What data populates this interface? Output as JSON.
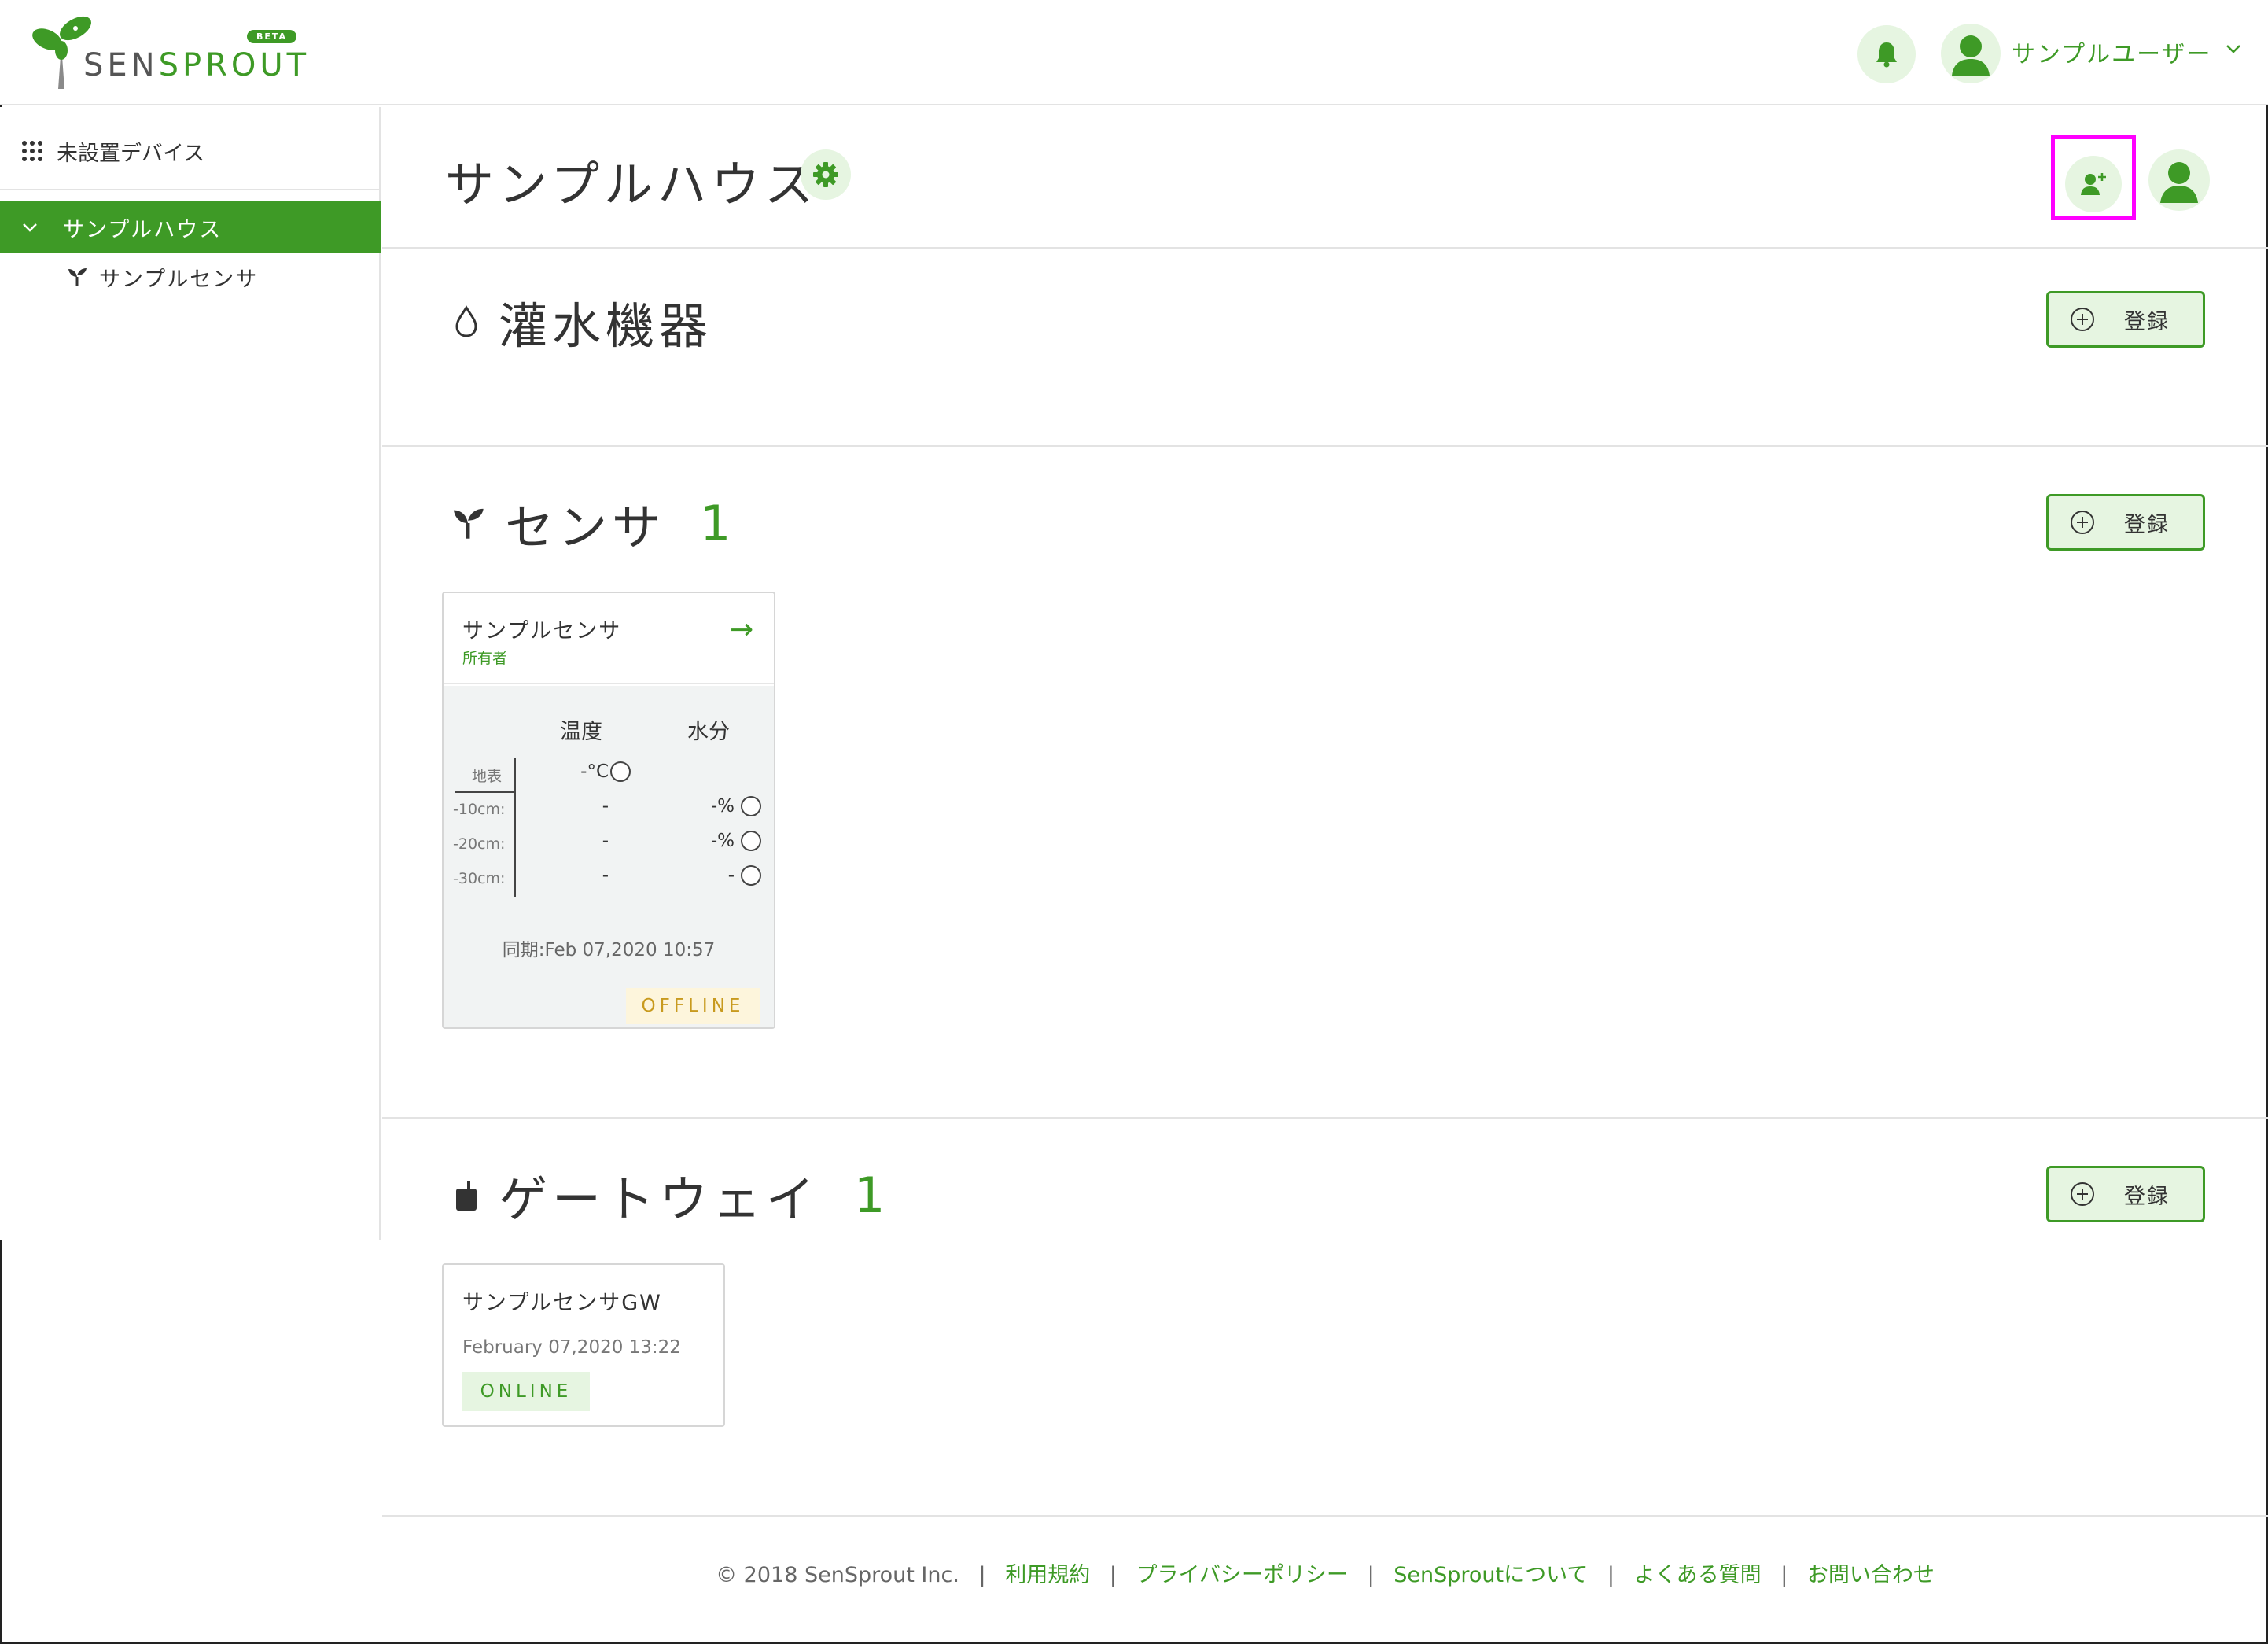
{
  "header": {
    "logo_text_a": "SEN",
    "logo_text_b": "SPROUT",
    "beta_badge": "BETA",
    "user_name": "サンプルユーザー"
  },
  "sidebar": {
    "unplaced_devices": "未設置デバイス",
    "house": "サンプルハウス",
    "sensor": "サンプルセンサ"
  },
  "main": {
    "house_title": "サンプルハウス",
    "irrigation": {
      "title": "灌水機器",
      "register_label": "登録"
    },
    "sensors": {
      "title": "センサ",
      "count": "1",
      "register_label": "登録",
      "card": {
        "name": "サンプルセンサ",
        "role": "所有者",
        "arrow": "→",
        "col_temp": "温度",
        "col_moisture": "水分",
        "rows": [
          {
            "depth": "地表",
            "temp": "-°C",
            "moisture": ""
          },
          {
            "depth": "-10cm:",
            "temp": "-",
            "moisture": "-%"
          },
          {
            "depth": "-20cm:",
            "temp": "-",
            "moisture": "-%"
          },
          {
            "depth": "-30cm:",
            "temp": "-",
            "moisture": "-"
          }
        ],
        "sync": "同期:Feb 07,2020 10:57",
        "status": "OFFLINE"
      }
    },
    "gateways": {
      "title": "ゲートウェイ",
      "count": "1",
      "register_label": "登録",
      "card": {
        "name": "サンプルセンサGW",
        "date": "February 07,2020 13:22",
        "status": "ONLINE"
      }
    }
  },
  "footer": {
    "copyright": "© 2018 SenSprout Inc.",
    "separator": "|",
    "links": [
      "利用規約",
      "プライバシーポリシー",
      "SenSproutについて",
      "よくある質問",
      "お問い合わせ"
    ]
  },
  "colors": {
    "accent": "#3e9a26",
    "accent_light": "#e6f5e1",
    "offline_bg": "#fdf5dc",
    "offline_text": "#c89a1e",
    "highlight": "#ff00ff"
  },
  "icons": [
    "sprout-logo-icon",
    "bell-icon",
    "user-avatar-icon",
    "chevron-down-icon",
    "grid-dots-icon",
    "sprout-icon",
    "gear-icon",
    "add-user-icon",
    "water-drop-icon",
    "plus-circle-icon",
    "gateway-icon",
    "status-circle-icon"
  ]
}
